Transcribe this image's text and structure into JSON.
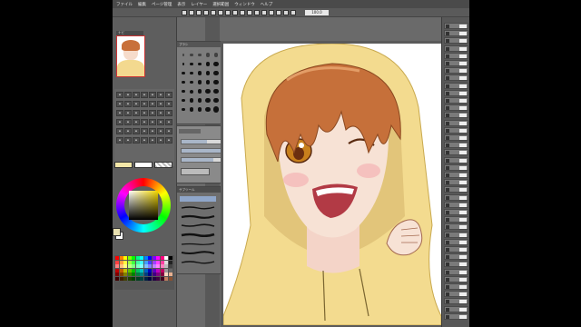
{
  "window": {
    "zoom_readout": "100.0"
  },
  "menu": {
    "items": [
      "ファイル",
      "編集",
      "ページ管理",
      "表示",
      "レイヤー",
      "選択範囲",
      "ウィンドウ",
      "ヘルプ"
    ]
  },
  "panels": {
    "navigator_tab": "ナビ",
    "brush_header": "ブラシ",
    "stroke_header": "サブツール"
  },
  "colors": {
    "hoodie": "#f3db8f",
    "hair": "#c6703a",
    "skin": "#f7e2d5",
    "eye": "#c8801c",
    "current_fg": "#e8e0b0",
    "current_bg": "#ffffff"
  },
  "palette": [
    "#ff0000",
    "#ff8000",
    "#ffff00",
    "#80ff00",
    "#00ff00",
    "#00ff80",
    "#00ffff",
    "#0080ff",
    "#0000ff",
    "#8000ff",
    "#ff00ff",
    "#ff0080",
    "#ffffff",
    "#000000",
    "#ff4040",
    "#ffa040",
    "#ffff40",
    "#a0ff40",
    "#40ff40",
    "#40ffa0",
    "#40ffff",
    "#40a0ff",
    "#4040ff",
    "#a040ff",
    "#ff40ff",
    "#ff40a0",
    "#dddddd",
    "#222222",
    "#ff8080",
    "#ffc080",
    "#ffff80",
    "#c0ff80",
    "#80ff80",
    "#80ffc0",
    "#80ffff",
    "#80c0ff",
    "#8080ff",
    "#c080ff",
    "#ff80ff",
    "#ff80c0",
    "#bbbbbb",
    "#444444",
    "#c00000",
    "#c06000",
    "#c0c000",
    "#60c000",
    "#00c000",
    "#00c060",
    "#00c0c0",
    "#0060c0",
    "#0000c0",
    "#6000c0",
    "#c000c0",
    "#c00060",
    "#999999",
    "#666666",
    "#800000",
    "#804000",
    "#808000",
    "#408000",
    "#008000",
    "#008040",
    "#008080",
    "#004080",
    "#000080",
    "#400080",
    "#800080",
    "#800040",
    "#f5d7c0",
    "#e8b090",
    "#400000",
    "#402000",
    "#404000",
    "#204000",
    "#004000",
    "#004020",
    "#004040",
    "#002040",
    "#000040",
    "#200040",
    "#400040",
    "#400020",
    "#c08060",
    "#8a5030"
  ],
  "brush_sizes": [
    3,
    4,
    5,
    6,
    7,
    8,
    9,
    10
  ],
  "tool_property": {
    "brush_size": 0.55,
    "opacity": 1.0,
    "density": 0.7
  }
}
